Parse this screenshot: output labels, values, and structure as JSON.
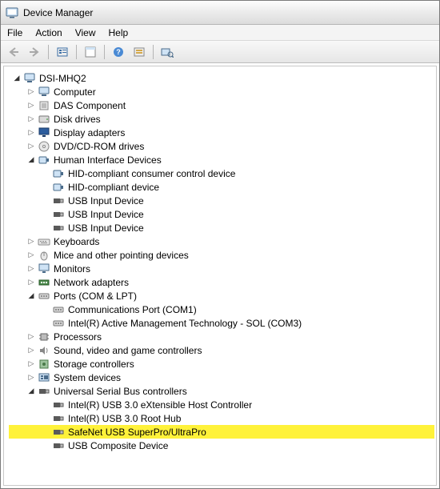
{
  "window": {
    "title": "Device Manager"
  },
  "menu": {
    "file": "File",
    "action": "Action",
    "view": "View",
    "help": "Help"
  },
  "toolbar": {
    "back": "Back",
    "forward": "Forward",
    "show_hidden": "Show hidden devices",
    "properties": "Properties",
    "help": "Help",
    "update": "Update driver",
    "scan": "Scan for hardware changes"
  },
  "tree": {
    "root": {
      "label": "DSI-MHQ2",
      "expanded": true
    },
    "nodes": [
      {
        "label": "Computer",
        "type": "computer",
        "expanded": false
      },
      {
        "label": "DAS Component",
        "type": "generic",
        "expanded": false
      },
      {
        "label": "Disk drives",
        "type": "disk",
        "expanded": false
      },
      {
        "label": "Display adapters",
        "type": "display",
        "expanded": false
      },
      {
        "label": "DVD/CD-ROM drives",
        "type": "dvd",
        "expanded": false
      },
      {
        "label": "Human Interface Devices",
        "type": "hid",
        "expanded": true,
        "children": [
          {
            "label": "HID-compliant consumer control device",
            "type": "hid"
          },
          {
            "label": "HID-compliant device",
            "type": "hid"
          },
          {
            "label": "USB Input Device",
            "type": "usb"
          },
          {
            "label": "USB Input Device",
            "type": "usb"
          },
          {
            "label": "USB Input Device",
            "type": "usb"
          }
        ]
      },
      {
        "label": "Keyboards",
        "type": "keyboard",
        "expanded": false
      },
      {
        "label": "Mice and other pointing devices",
        "type": "mouse",
        "expanded": false
      },
      {
        "label": "Monitors",
        "type": "monitor",
        "expanded": false
      },
      {
        "label": "Network adapters",
        "type": "network",
        "expanded": false
      },
      {
        "label": "Ports (COM & LPT)",
        "type": "port",
        "expanded": true,
        "children": [
          {
            "label": "Communications Port (COM1)",
            "type": "port"
          },
          {
            "label": "Intel(R) Active Management Technology - SOL (COM3)",
            "type": "port"
          }
        ]
      },
      {
        "label": "Processors",
        "type": "cpu",
        "expanded": false
      },
      {
        "label": "Sound, video and game controllers",
        "type": "sound",
        "expanded": false
      },
      {
        "label": "Storage controllers",
        "type": "storage",
        "expanded": false
      },
      {
        "label": "System devices",
        "type": "system",
        "expanded": false
      },
      {
        "label": "Universal Serial Bus controllers",
        "type": "usb",
        "expanded": true,
        "children": [
          {
            "label": "Intel(R) USB 3.0 eXtensible Host Controller",
            "type": "usb"
          },
          {
            "label": "Intel(R) USB 3.0 Root Hub",
            "type": "usb"
          },
          {
            "label": "SafeNet USB SuperPro/UltraPro",
            "type": "usb",
            "highlight": true
          },
          {
            "label": "USB Composite Device",
            "type": "usb"
          }
        ]
      }
    ]
  },
  "icons": {
    "computer": "computer-icon",
    "generic": "chip-icon",
    "disk": "disk-icon",
    "display": "display-icon",
    "dvd": "dvd-icon",
    "hid": "hid-icon",
    "usb": "usb-icon",
    "keyboard": "keyboard-icon",
    "mouse": "mouse-icon",
    "monitor": "monitor-icon",
    "network": "network-icon",
    "port": "port-icon",
    "cpu": "cpu-icon",
    "sound": "sound-icon",
    "storage": "storage-icon",
    "system": "system-icon"
  }
}
